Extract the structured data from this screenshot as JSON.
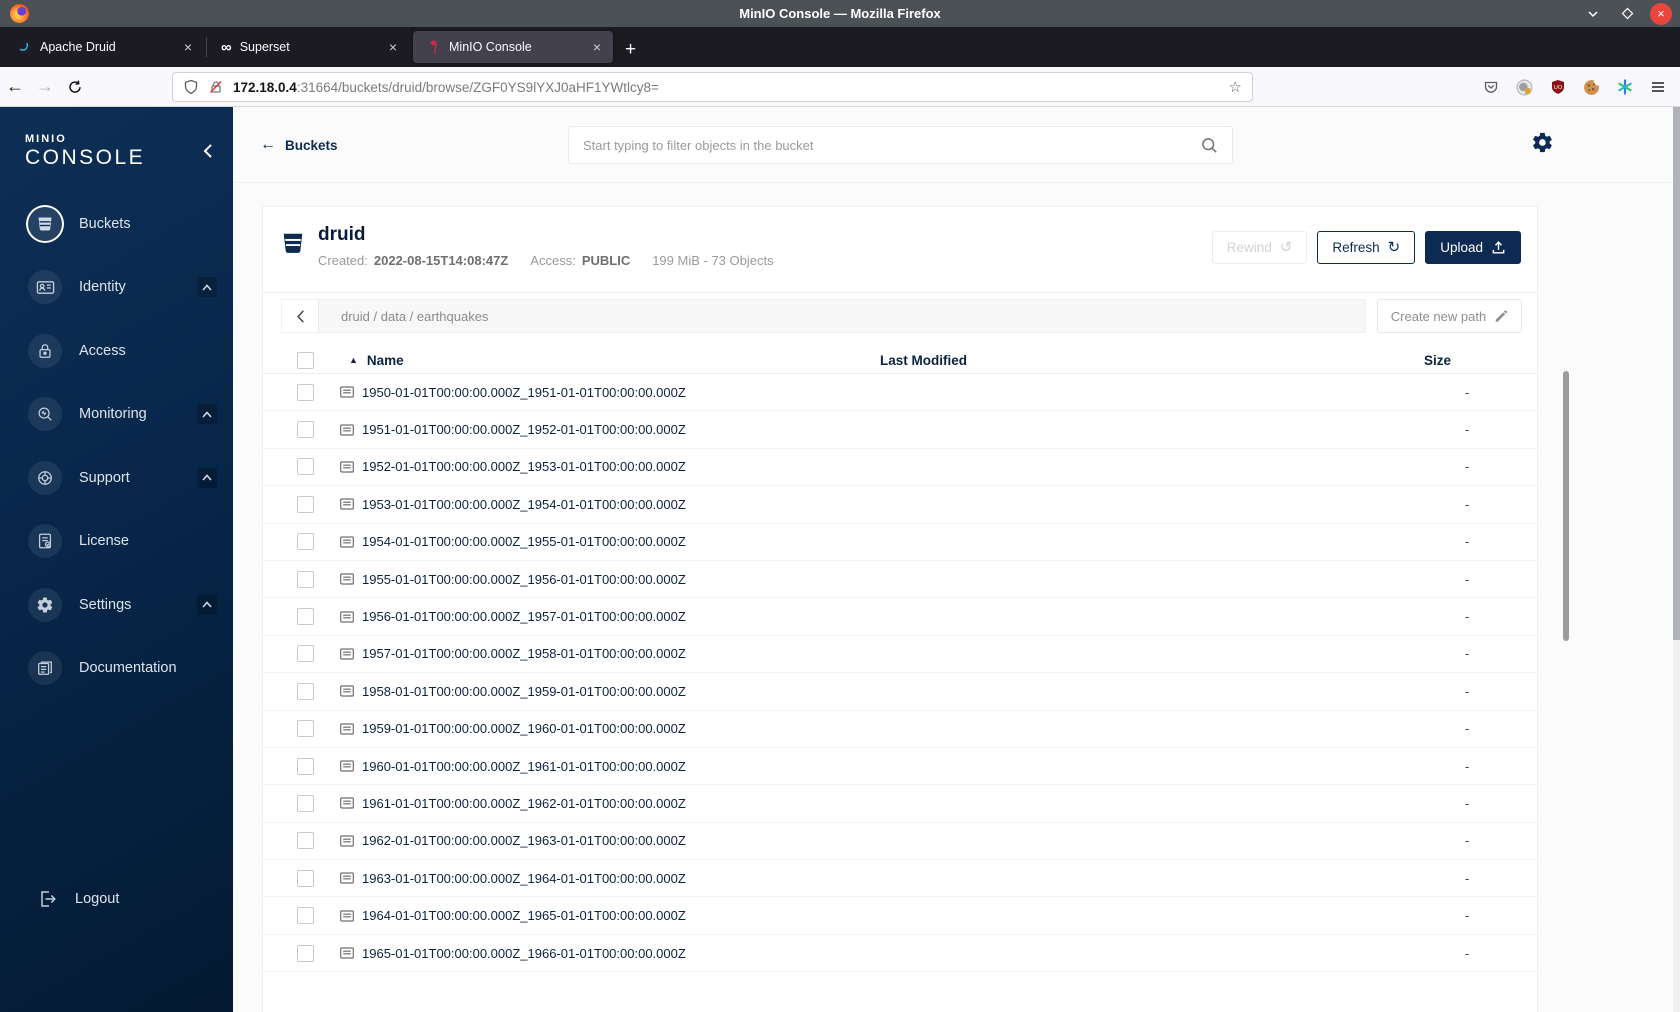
{
  "window": {
    "title": "MinIO Console — Mozilla Firefox"
  },
  "tabs": [
    {
      "label": "Apache Druid"
    },
    {
      "label": "Superset"
    },
    {
      "label": "MinIO Console"
    }
  ],
  "browser_chrome": {
    "url_host": "172.18.0.4",
    "url_rest": ":31664/buckets/druid/browse/ZGF0YS9lYXJ0aHF1YWtlcy8="
  },
  "sidebar": {
    "brand_line1": "MINIO",
    "brand_line2": "CONSOLE",
    "items": [
      {
        "label": "Buckets"
      },
      {
        "label": "Identity"
      },
      {
        "label": "Access"
      },
      {
        "label": "Monitoring"
      },
      {
        "label": "Support"
      },
      {
        "label": "License"
      },
      {
        "label": "Settings"
      },
      {
        "label": "Documentation"
      }
    ],
    "logout": "Logout"
  },
  "page": {
    "back_label": "Buckets",
    "search_placeholder": "Start typing to filter objects in the bucket"
  },
  "bucket": {
    "name": "druid",
    "created_label": "Created:",
    "created_value": "2022-08-15T14:08:47Z",
    "access_label": "Access:",
    "access_value": "PUBLIC",
    "usage": "199 MiB - 73 Objects",
    "rewind_label": "Rewind",
    "refresh_label": "Refresh",
    "upload_label": "Upload"
  },
  "path_bar": {
    "path": "druid / data / earthquakes",
    "create_label": "Create new path"
  },
  "table": {
    "col_name": "Name",
    "col_modified": "Last Modified",
    "col_size": "Size",
    "rows": [
      {
        "name": "1950-01-01T00:00:00.000Z_1951-01-01T00:00:00.000Z",
        "size": "-"
      },
      {
        "name": "1951-01-01T00:00:00.000Z_1952-01-01T00:00:00.000Z",
        "size": "-"
      },
      {
        "name": "1952-01-01T00:00:00.000Z_1953-01-01T00:00:00.000Z",
        "size": "-"
      },
      {
        "name": "1953-01-01T00:00:00.000Z_1954-01-01T00:00:00.000Z",
        "size": "-"
      },
      {
        "name": "1954-01-01T00:00:00.000Z_1955-01-01T00:00:00.000Z",
        "size": "-"
      },
      {
        "name": "1955-01-01T00:00:00.000Z_1956-01-01T00:00:00.000Z",
        "size": "-"
      },
      {
        "name": "1956-01-01T00:00:00.000Z_1957-01-01T00:00:00.000Z",
        "size": "-"
      },
      {
        "name": "1957-01-01T00:00:00.000Z_1958-01-01T00:00:00.000Z",
        "size": "-"
      },
      {
        "name": "1958-01-01T00:00:00.000Z_1959-01-01T00:00:00.000Z",
        "size": "-"
      },
      {
        "name": "1959-01-01T00:00:00.000Z_1960-01-01T00:00:00.000Z",
        "size": "-"
      },
      {
        "name": "1960-01-01T00:00:00.000Z_1961-01-01T00:00:00.000Z",
        "size": "-"
      },
      {
        "name": "1961-01-01T00:00:00.000Z_1962-01-01T00:00:00.000Z",
        "size": "-"
      },
      {
        "name": "1962-01-01T00:00:00.000Z_1963-01-01T00:00:00.000Z",
        "size": "-"
      },
      {
        "name": "1963-01-01T00:00:00.000Z_1964-01-01T00:00:00.000Z",
        "size": "-"
      },
      {
        "name": "1964-01-01T00:00:00.000Z_1965-01-01T00:00:00.000Z",
        "size": "-"
      },
      {
        "name": "1965-01-01T00:00:00.000Z_1966-01-01T00:00:00.000Z",
        "size": "-"
      }
    ]
  },
  "colors": {
    "accent_navy": "#0d2b52",
    "sidebar_top": "#0e2f55",
    "sidebar_bottom": "#041a32",
    "close_red": "#e8453c",
    "ubo_red": "#8c1016",
    "minio_red": "#c72c48"
  }
}
